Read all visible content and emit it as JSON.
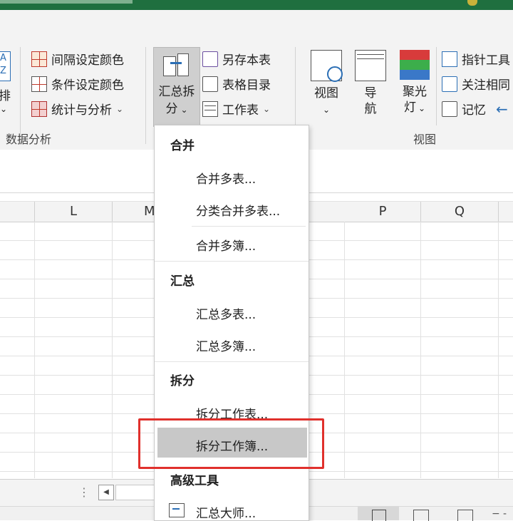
{
  "ribbon": {
    "left_partial": {
      "top": "A",
      "mid": "Z",
      "label": "排"
    },
    "data_analysis": {
      "items": [
        "间隔设定颜色",
        "条件设定颜色",
        "统计与分析"
      ],
      "group_label": "数据分析"
    },
    "summary_split": {
      "line1": "汇总拆",
      "line2": "分"
    },
    "file_items": [
      "另存本表",
      "表格目录",
      "工作表"
    ],
    "view": {
      "view_btn": "视图",
      "nav_line1": "导",
      "nav_line2": "航",
      "spot_line1": "聚光",
      "spot_line2": "灯",
      "right_items": [
        "指针工具",
        "关注相同",
        "记忆"
      ],
      "group_label": "视图"
    }
  },
  "columns": [
    "L",
    "M",
    "P",
    "Q"
  ],
  "menu": {
    "sections": [
      {
        "header": "合并",
        "items": [
          "合并多表...",
          "分类合并多表...",
          "合并多簿..."
        ]
      },
      {
        "header": "汇总",
        "items": [
          "汇总多表...",
          "汇总多簿..."
        ]
      },
      {
        "header": "拆分",
        "items": [
          "拆分工作表...",
          "拆分工作簿..."
        ]
      },
      {
        "header": "高级工具",
        "items": [
          "汇总大师..."
        ]
      }
    ],
    "highlighted": "拆分工作簿..."
  },
  "colors": {
    "highlight_box": "#e0302c",
    "title_bar": "#1f6f3f",
    "menu_hover": "#c8c8c8"
  }
}
